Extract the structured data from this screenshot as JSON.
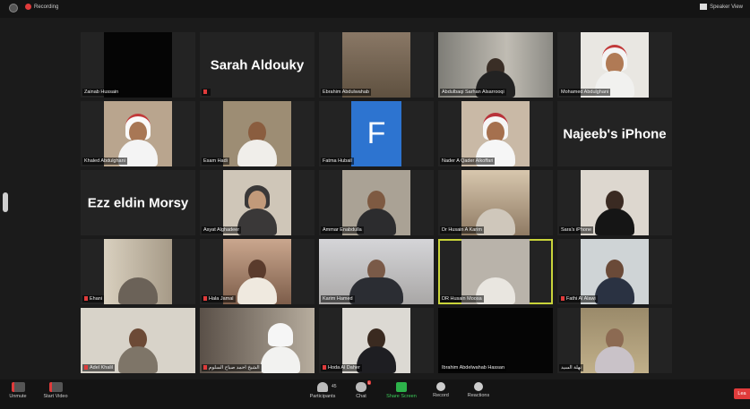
{
  "topbar": {
    "recording": "Recording",
    "speaker_view": "Speaker View"
  },
  "tiles": [
    {
      "name": "Zainab Hussain"
    },
    {
      "name": "Sarah Aldouky"
    },
    {
      "name": "Ebrahim Abdulwahab"
    },
    {
      "name": "Abdulbaqi Sarhan Alsarrooqi"
    },
    {
      "name": "Mohamed Abdulghani"
    },
    {
      "name": "Khaled Abdulghani"
    },
    {
      "name": "Esam Hadi"
    },
    {
      "name": "Fatma Hubail",
      "letter": "F"
    },
    {
      "name": "Nader A Qader Alkoffari"
    },
    {
      "name": "Najeeb's iPhone"
    },
    {
      "name": "Ezz eldin Morsy"
    },
    {
      "name": "Asyat Alghadeer"
    },
    {
      "name": "Ammar Enabdulla"
    },
    {
      "name": "Dr Husain A Karim"
    },
    {
      "name": "Sara's iPhone"
    },
    {
      "name": "Ehani"
    },
    {
      "name": "Hala Jamal"
    },
    {
      "name": "Karim Hamed"
    },
    {
      "name": "DR Husain Moosa"
    },
    {
      "name": "Fathi Al Alawi"
    },
    {
      "name": "Adel Khalil"
    },
    {
      "name": "الشيخ احمد صباح السلوم"
    },
    {
      "name": "Hoda Al Daher"
    },
    {
      "name": "Ibrahim Abdelwahab Hassan"
    },
    {
      "name": "نهلة السيد"
    }
  ],
  "toolbar": {
    "unmute": "Unmute",
    "start_video": "Start Video",
    "participants": "Participants",
    "participants_count": "45",
    "chat": "Chat",
    "chat_badge": "1",
    "share_screen": "Share Screen",
    "record": "Record",
    "reactions": "Reactions",
    "leave": "Lea"
  }
}
